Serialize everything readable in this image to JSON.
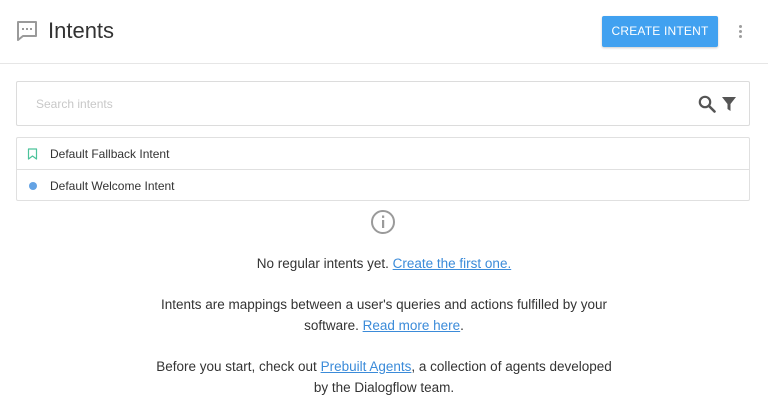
{
  "header": {
    "title": "Intents",
    "create_button_label": "CREATE INTENT",
    "title_icon": "chat-bubble-icon",
    "more_icon": "more-vertical-icon"
  },
  "search": {
    "placeholder": "Search intents",
    "value": "",
    "search_icon": "search-icon",
    "filter_icon": "filter-icon"
  },
  "intents": [
    {
      "label": "Default Fallback Intent",
      "icon": "bookmark-icon"
    },
    {
      "label": "Default Welcome Intent",
      "icon": "status-dot-icon"
    }
  ],
  "empty_state": {
    "icon": "info-icon",
    "message": "No regular intents yet.",
    "message_link": "Create the first one.",
    "description_1": "Intents are mappings between a user's queries and actions fulfilled by your software.",
    "description_1_link": "Read more here",
    "description_1_end": ".",
    "description_2_start": "Before you start, check out",
    "description_2_link": "Prebuilt Agents",
    "description_2_end": ", a collection of agents developed by the Dialogflow team."
  },
  "colors": {
    "accent": "#41a1f0",
    "link": "#3b8bd9",
    "fallback_icon": "#4cc39b",
    "welcome_dot": "#64a3e4"
  }
}
